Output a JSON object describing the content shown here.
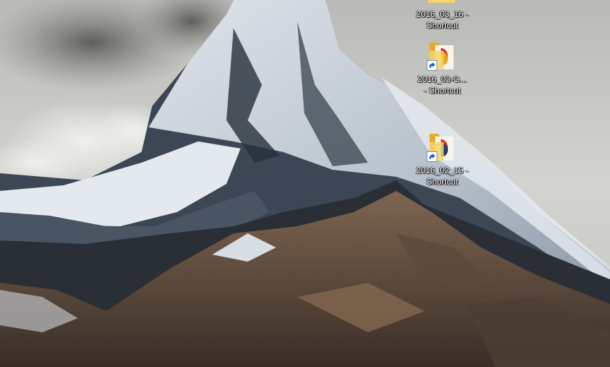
{
  "desktop": {
    "icons": [
      {
        "line1": "2016_03_16 -",
        "line2": "Shortcut",
        "icon": "folder-shortcut-icon"
      },
      {
        "line1": "2016_03-G...",
        "line2": "- Shortcut",
        "icon": "folder-shortcut-icon"
      },
      {
        "line1": "2016_02_15 -",
        "line2": "Shortcut",
        "icon": "folder-shortcut-icon"
      }
    ]
  },
  "colors": {
    "sky": "#c8c9c4",
    "snow": "#e9eef2",
    "rock_dark": "#2b3440",
    "foothills": "#6e5a48",
    "folder": "#f0c94d"
  }
}
